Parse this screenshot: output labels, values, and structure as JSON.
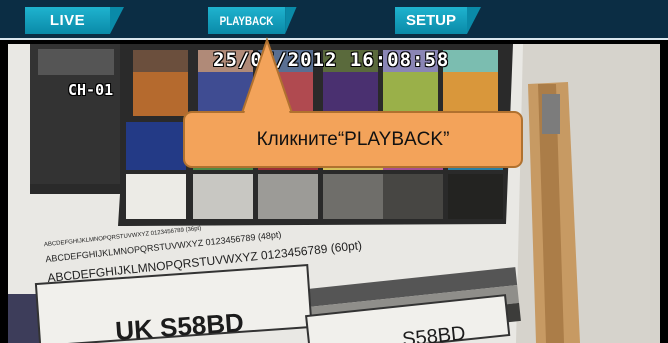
{
  "nav": {
    "tabs": [
      {
        "label": "LIVE"
      },
      {
        "label": "PLAYBACK"
      },
      {
        "label": "SETUP"
      }
    ]
  },
  "camera": {
    "timestamp": "25/07/2012 16:08:58",
    "channel": "CH-01",
    "chart_lines": [
      "ABCDEFGHIJKLMNOPQRSTUVWXYZ 0123456789 (36pt)",
      "ABCDEFGHIJKLMNOPQRSTUVWXYZ 0123456789 (48pt)",
      "ABCDEFGHIJKLMNOPQRSTUVWXYZ 0123456789 (60pt)"
    ],
    "plate_text": "UK S58BD",
    "plate_text_2": "S58BD"
  },
  "callout": {
    "text": "Кликните“PLAYBACK”"
  },
  "colors": {
    "topbar": "#0b2d44",
    "tab": "#1fb3cf",
    "callout": "#f3a35a"
  }
}
